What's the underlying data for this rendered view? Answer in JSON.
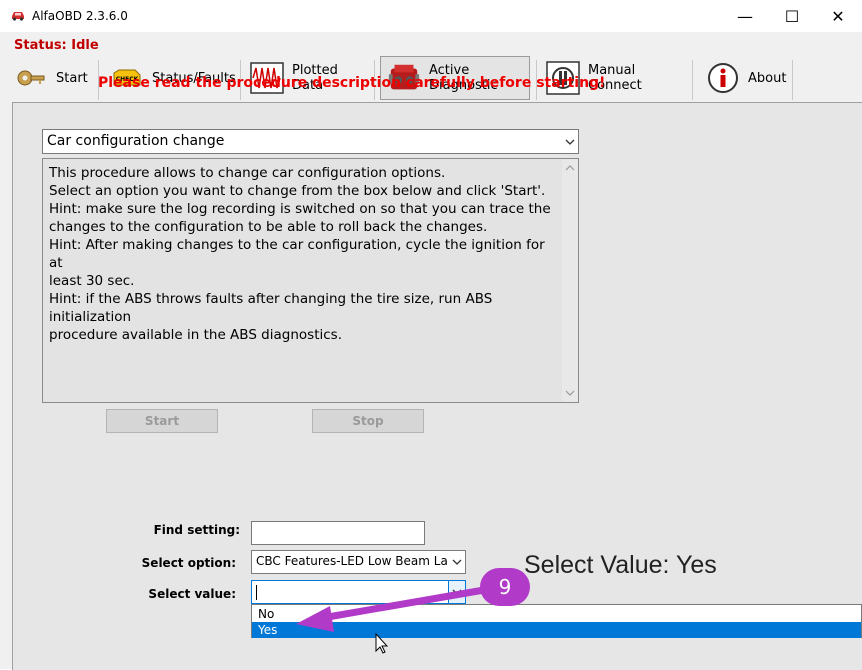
{
  "window": {
    "title": "AlfaOBD 2.3.6.0",
    "minimize": "—",
    "maximize": "☐",
    "close": "✕"
  },
  "status": "Status: Idle",
  "toolbar": [
    {
      "label": "Start",
      "icon": "key-icon"
    },
    {
      "label": "Status/Faults",
      "icon": "check-engine-icon"
    },
    {
      "label": "Plotted Data",
      "icon": "oscilloscope-icon"
    },
    {
      "label": "Active Diagnostic",
      "icon": "engine-icon"
    },
    {
      "label": "Manual Connect",
      "icon": "connector-icon"
    },
    {
      "label": "About",
      "icon": "info-icon"
    }
  ],
  "notice": "Please read the procedure description carefully before starting!",
  "procedure": {
    "selected": "Car configuration change"
  },
  "description": [
    "This procedure allows to change car configuration options.",
    "Select an option you want to change from the box below and click 'Start'.",
    "Hint: make sure the log recording is switched on so that you can trace the",
    "changes to the configuration to be able to roll back the changes.",
    "Hint: After making changes to the car configuration, cycle the ignition for at",
    "least 30 sec.",
    "Hint: if the ABS throws faults after changing the tire size, run ABS initialization",
    "procedure available in the ABS diagnostics."
  ],
  "buttons": {
    "start": "Start",
    "stop": "Stop"
  },
  "form": {
    "find_label": "Find setting:",
    "find_value": "",
    "option_label": "Select option:",
    "option_value": "CBC Features-LED Low Beam Lamp",
    "value_label": "Select value:",
    "value_value": ""
  },
  "dropdown_options": [
    "No",
    "Yes"
  ],
  "annotation": {
    "text": "Select Value: Yes",
    "step": "9"
  },
  "colors": {
    "accent": "#0078d7",
    "warning": "#ee0000",
    "status": "#c00000",
    "arrow": "#b13bc8"
  }
}
